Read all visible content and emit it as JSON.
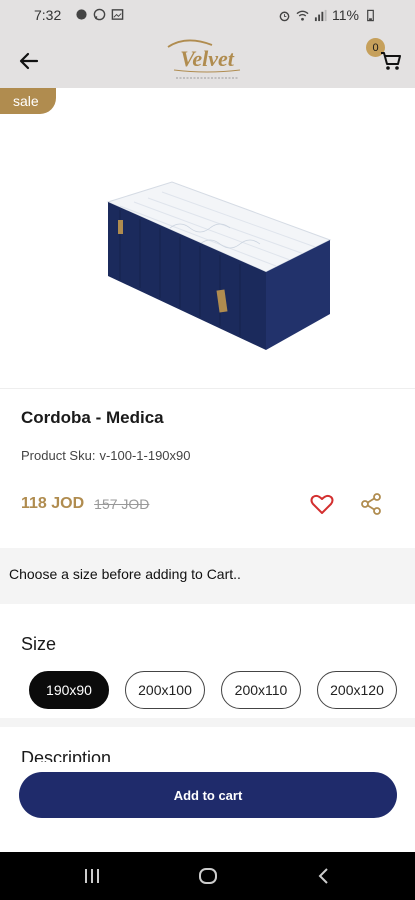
{
  "status_bar": {
    "time": "7:32",
    "battery": "11%"
  },
  "header": {
    "back_icon": "arrow-left-icon",
    "logo_brand": "Velvet",
    "logo_tagline": "Sleep Well Dream Well",
    "cart_icon": "cart-icon",
    "cart_count": "0"
  },
  "product": {
    "sale_label": "sale",
    "title": "Cordoba - Medica",
    "sku_label": "Product Sku:",
    "sku_value": "v-100-1-190x90",
    "price_current": "118 JOD",
    "price_old": "157 JOD"
  },
  "notice": {
    "text": "Choose a size before adding to Cart.."
  },
  "size_section": {
    "heading": "Size",
    "options": [
      "190x90",
      "200x100",
      "200x110",
      "200x120"
    ],
    "selected": "190x90"
  },
  "description": {
    "heading": "Description"
  },
  "cart_bar": {
    "add_to_cart_label": "Add to cart"
  },
  "colors": {
    "gold": "#b08c4f",
    "navy": "#1f2b6b",
    "header_bg": "#e3e1e1"
  }
}
